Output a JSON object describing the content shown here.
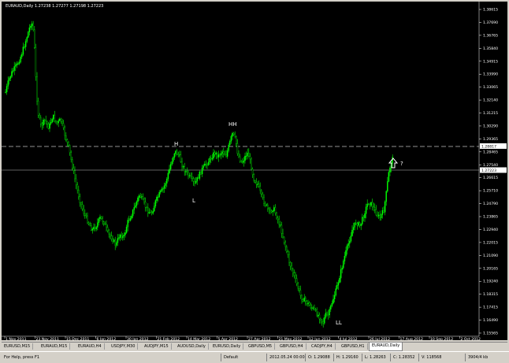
{
  "chart": {
    "title_text": "EURAUD,Daily  1.27238 1.27277 1.27198 1.27223",
    "current_price_label": "1.27223",
    "dashed_level_label": "1.28817",
    "y_ticks": [
      "1.38615",
      "1.37690",
      "1.36765",
      "1.35840",
      "1.34915",
      "1.33990",
      "1.33065",
      "1.32140",
      "1.31215",
      "1.30290",
      "1.29365",
      "1.28465",
      "1.27540",
      "1.26615",
      "1.25710",
      "1.24790",
      "1.23865",
      "1.22940",
      "1.22015",
      "1.21090",
      "1.20165",
      "1.19240",
      "1.18315",
      "1.17415",
      "1.16490",
      "1.15565"
    ],
    "x_ticks": [
      "1 Nov 2011",
      "23 Nov 2011",
      "15 Dec 2011",
      "6 Jan 2012",
      "30 Jan 2012",
      "21 Feb 2012",
      "14 Mar 2012",
      "5 Apr 2012",
      "27 Apr 2012",
      "21 May 2012",
      "12 Jun 2012",
      "4 Jul 2012",
      "26 Jul 2012",
      "17 Aug 2012",
      "10 Sep 2012",
      "2 Oct 2012"
    ],
    "annotations": {
      "h": "H",
      "l": "L",
      "hh": "HH",
      "ll": "LL",
      "question": "?"
    },
    "colors": {
      "background": "#000000",
      "candle": "#00ff00",
      "axis_text": "#ffffff",
      "level_line": "#c0c0c0"
    },
    "icons": {
      "arrow": "up-arrow-icon"
    }
  },
  "tabs": [
    {
      "label": "EURUSD,M15"
    },
    {
      "label": "EURAUD,M15"
    },
    {
      "label": "EURAUD,H4"
    },
    {
      "label": "USDJPY,M30"
    },
    {
      "label": "AUDJPY,M15"
    },
    {
      "label": "AUDUSD,Daily"
    },
    {
      "label": "EURUSD,Daily"
    },
    {
      "label": "GBPUSD,M5"
    },
    {
      "label": "GBPUSD,H4"
    },
    {
      "label": "CADJPY,H4"
    },
    {
      "label": "GBPUSD,H1"
    },
    {
      "label": "EURAUD,Daily"
    }
  ],
  "status": {
    "help": "For Help, press F1",
    "profile": "Default",
    "datetime": "2012.05.24 00:00",
    "open": "O: 1.29088",
    "high": "H: 1.29160",
    "low": "L: 1.28263",
    "close": "C: 1.28352",
    "volume": "V: 118568",
    "traffic": "3904/4 kb"
  }
}
